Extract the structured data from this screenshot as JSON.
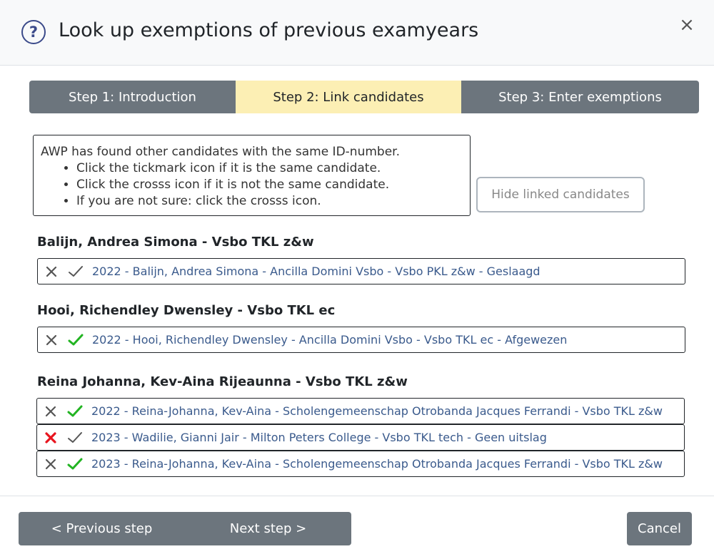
{
  "modal": {
    "title": "Look up exemptions of previous examyears",
    "help_icon": "?",
    "close_icon": "×"
  },
  "steps": [
    {
      "label": "Step 1: Introduction",
      "active": false
    },
    {
      "label": "Step 2: Link candidates",
      "active": true
    },
    {
      "label": "Step 3: Enter exemptions",
      "active": false
    }
  ],
  "info": {
    "intro": "AWP has found other candidates with the same ID-number.",
    "bullets": [
      "Click the tickmark icon if it is the same candidate.",
      "Click the crosss icon if it is not the same candidate.",
      "If you are not sure: click the crosss icon."
    ]
  },
  "hide_button_label": "Hide linked candidates",
  "candidates": [
    {
      "name": "Balijn, Andrea Simona - Vsbo TKL z&w",
      "links": [
        {
          "text": "2022 - Balijn, Andrea Simona - Ancilla Domini Vsbo - Vsbo PKL z&w - Geslaagd",
          "state": "none"
        }
      ]
    },
    {
      "name": "Hooi, Richendley Dwensley - Vsbo TKL ec",
      "links": [
        {
          "text": "2022 - Hooi, Richendley Dwensley - Ancilla Domini Vsbo - Vsbo TKL ec - Afgewezen",
          "state": "linked"
        }
      ]
    },
    {
      "name": "Reina Johanna, Kev-Aina Rijeaunna - Vsbo TKL z&w",
      "links": [
        {
          "text": "2022 - Reina-Johanna, Kev-Aina - Scholengemeenschap Otrobanda Jacques Ferrandi - Vsbo TKL z&w",
          "state": "linked"
        },
        {
          "text": "2023 - Wadilie, Gianni Jair - Milton Peters College - Vsbo TKL tech - Geen uitslag",
          "state": "not_linked"
        },
        {
          "text": "2023 - Reina-Johanna, Kev-Aina - Scholengemeenschap Otrobanda Jacques Ferrandi - Vsbo TKL z&w",
          "state": "linked"
        }
      ]
    }
  ],
  "footer": {
    "prev_label": "< Previous step",
    "next_label": "Next step >",
    "cancel_label": "Cancel"
  },
  "colors": {
    "active_step": "#fcefb4",
    "button_gray": "#6c757d",
    "check_green": "#22b422",
    "cross_red": "#e8141e",
    "neutral_icon": "#555555",
    "link_text": "#3a5a8c"
  }
}
